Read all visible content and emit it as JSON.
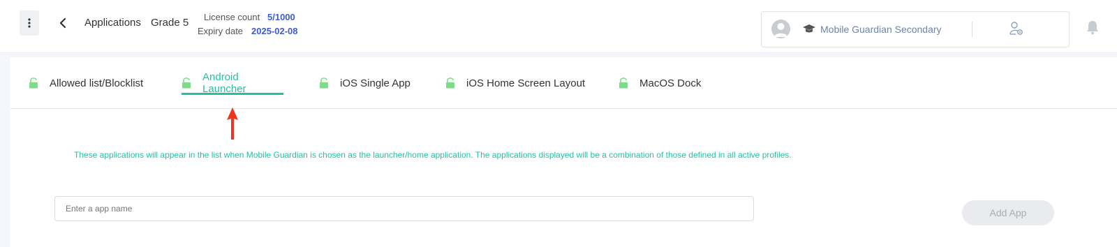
{
  "header": {
    "breadcrumb_app": "Applications",
    "breadcrumb_grade": "Grade 5",
    "license_label": "License count",
    "license_value": "5/1000",
    "expiry_label": "Expiry date",
    "expiry_value": "2025-02-08",
    "school_name": "Mobile Guardian Secondary",
    "icons": [
      "kebab-menu-icon",
      "chevron-left-icon",
      "avatar-icon",
      "graduation-cap-icon",
      "user-settings-icon",
      "bell-icon"
    ]
  },
  "tabs": [
    {
      "label": "Allowed list/Blocklist",
      "active": false,
      "icon": "unlocked-icon"
    },
    {
      "label": "Android Launcher",
      "active": true,
      "icon": "unlocked-icon"
    },
    {
      "label": "iOS Single App",
      "active": false,
      "icon": "unlocked-icon"
    },
    {
      "label": "iOS Home Screen Layout",
      "active": false,
      "icon": "unlocked-icon"
    },
    {
      "label": "MacOS Dock",
      "active": false,
      "icon": "unlocked-icon"
    }
  ],
  "main": {
    "info_text": "These applications will appear in the list when Mobile Guardian is chosen as the launcher/home application. The applications displayed will be a combination of those defined in all active profiles.",
    "app_input_placeholder": "Enter a app name",
    "app_input_value": "",
    "add_app_label": "Add App"
  },
  "colors": {
    "accent": "#21c2a4",
    "link_blue": "#3b5bd6",
    "lock_green": "#7ddc8a",
    "annotation_arrow": "#f0321e"
  }
}
